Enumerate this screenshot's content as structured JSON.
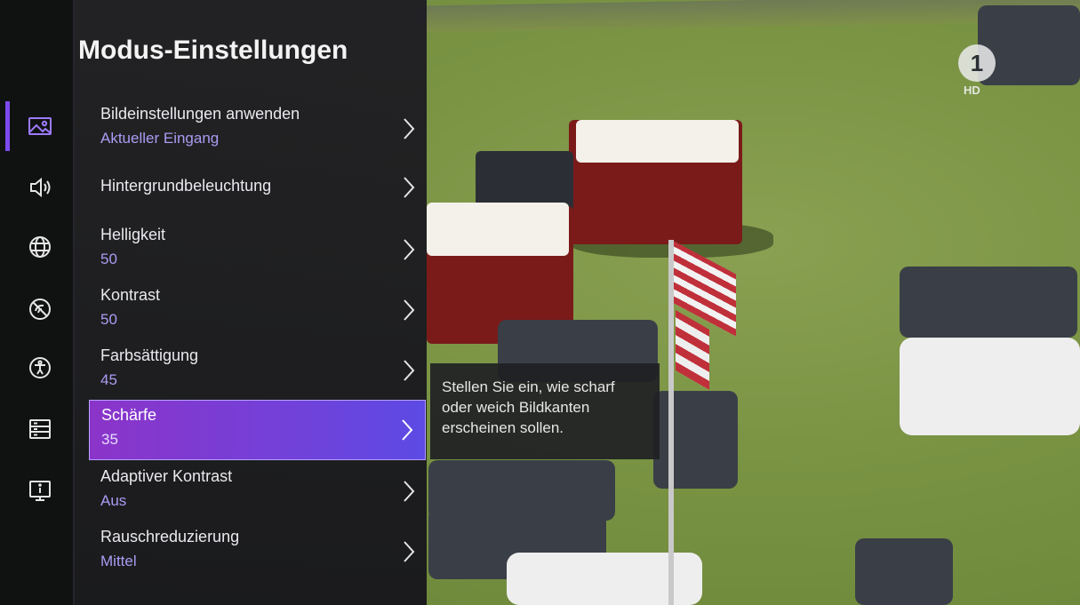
{
  "panel": {
    "title": "Modus-Einstellungen",
    "rows": [
      {
        "label": "Bildeinstellungen anwenden",
        "value": "Aktueller Eingang"
      },
      {
        "label": "Hintergrundbeleuchtung",
        "value": ""
      },
      {
        "label": "Helligkeit",
        "value": "50"
      },
      {
        "label": "Kontrast",
        "value": "50"
      },
      {
        "label": "Farbsättigung",
        "value": "45"
      },
      {
        "label": "Schärfe",
        "value": "35",
        "selected": true
      },
      {
        "label": "Adaptiver Kontrast",
        "value": "Aus"
      },
      {
        "label": "Rauschreduzierung",
        "value": "Mittel"
      }
    ]
  },
  "tooltip": {
    "text": "Stellen Sie ein, wie scharf oder weich Bildkanten erscheinen sollen."
  },
  "rail": {
    "items": [
      {
        "icon": "picture-icon",
        "active": true
      },
      {
        "icon": "sound-icon"
      },
      {
        "icon": "globe-icon"
      },
      {
        "icon": "no-signal-icon"
      },
      {
        "icon": "accessibility-icon"
      },
      {
        "icon": "storage-icon"
      },
      {
        "icon": "info-icon"
      }
    ]
  },
  "channel": {
    "logo_text": "1",
    "badge": "HD"
  },
  "colors": {
    "accent": "#7b4bf0",
    "value_text": "#a99cf3"
  }
}
